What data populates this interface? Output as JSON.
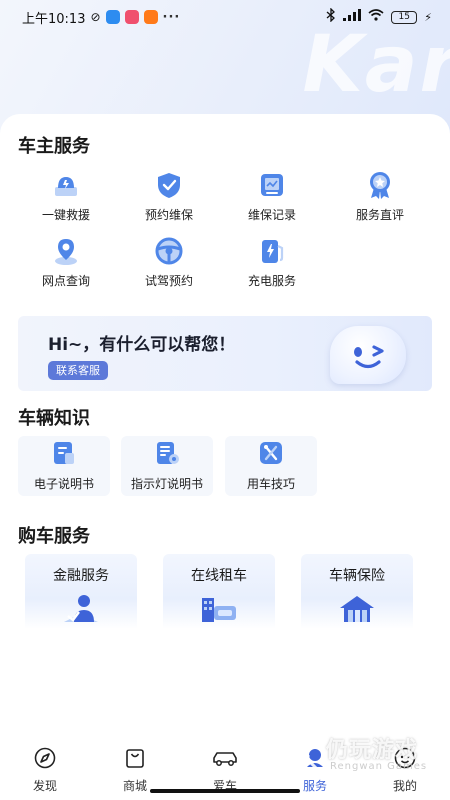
{
  "status_bar": {
    "time": "上午10:13",
    "more": "···",
    "battery": "15"
  },
  "brand_watermark": "Kar",
  "owner_services": {
    "title": "车主服务",
    "items": [
      {
        "label": "一键救援",
        "icon": "rescue-icon"
      },
      {
        "label": "预约维保",
        "icon": "shield-check-icon"
      },
      {
        "label": "维保记录",
        "icon": "record-icon"
      },
      {
        "label": "服务直评",
        "icon": "medal-icon"
      },
      {
        "label": "网点查询",
        "icon": "location-icon"
      },
      {
        "label": "试驾预约",
        "icon": "steering-wheel-icon"
      },
      {
        "label": "充电服务",
        "icon": "charging-icon"
      }
    ]
  },
  "help_banner": {
    "title": "Hi~，有什么可以帮您！",
    "button": "联系客服"
  },
  "vehicle_knowledge": {
    "title": "车辆知识",
    "items": [
      {
        "label": "电子说明书",
        "icon": "manual-icon"
      },
      {
        "label": "指示灯说明书",
        "icon": "indicator-manual-icon"
      },
      {
        "label": "用车技巧",
        "icon": "tools-icon"
      }
    ]
  },
  "purchase_services": {
    "title": "购车服务",
    "items": [
      {
        "label": "金融服务",
        "icon": "finance-icon"
      },
      {
        "label": "在线租车",
        "icon": "rental-icon"
      },
      {
        "label": "车辆保险",
        "icon": "insurance-icon"
      }
    ]
  },
  "tabbar": {
    "active": "服务",
    "items": [
      {
        "label": "发现",
        "icon": "compass-icon"
      },
      {
        "label": "商城",
        "icon": "shopping-bag-icon"
      },
      {
        "label": "爱车",
        "icon": "car-icon"
      },
      {
        "label": "服务",
        "icon": "service-icon"
      },
      {
        "label": "我的",
        "icon": "profile-icon"
      }
    ]
  },
  "watermark": {
    "text": "仍玩游戏",
    "sub": "Rengwan Games"
  },
  "colors": {
    "accent": "#3e63d8",
    "icon_blue": "#4f86e8",
    "button_blue": "#5d79d9"
  }
}
